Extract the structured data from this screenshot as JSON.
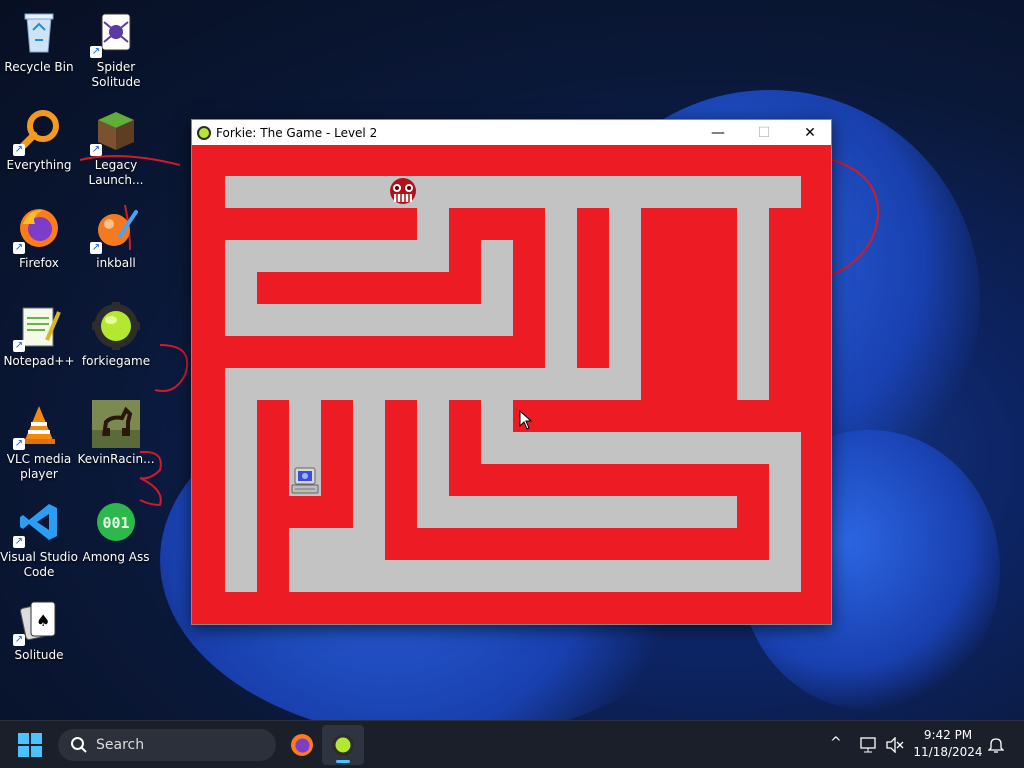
{
  "desktop": {
    "icons": [
      {
        "id": "recycle-bin",
        "label": "Recycle Bin"
      },
      {
        "id": "spider-solitude",
        "label": "Spider\nSolitude"
      },
      {
        "id": "everything",
        "label": "Everything"
      },
      {
        "id": "legacy-launcher",
        "label": "Legacy\nLaunch..."
      },
      {
        "id": "firefox",
        "label": "Firefox"
      },
      {
        "id": "inkball",
        "label": "inkball"
      },
      {
        "id": "notepadpp",
        "label": "Notepad++"
      },
      {
        "id": "forkiegame",
        "label": "forkiegame"
      },
      {
        "id": "vlc",
        "label": "VLC media\nplayer"
      },
      {
        "id": "kevinracing",
        "label": "KevinRacin..."
      },
      {
        "id": "vscode",
        "label": "Visual Studio\nCode"
      },
      {
        "id": "among-ass",
        "label": "Among Ass"
      },
      {
        "id": "solitude",
        "label": "Solitude"
      }
    ],
    "among_ass_badge": "001"
  },
  "window": {
    "title": "Forkie: The Game - Level 2",
    "minimize_glyph": "—",
    "maximize_glyph": "☐",
    "close_glyph": "✕"
  },
  "game": {
    "wall_color": "#ed1c24",
    "path_color": "#c3c3c3",
    "enemy": "red-skull-sprite",
    "player": "computer-sprite"
  },
  "taskbar": {
    "search_placeholder": "Search",
    "time": "9:42 PM",
    "date": "11/18/2024",
    "tray_chevron": "^"
  }
}
